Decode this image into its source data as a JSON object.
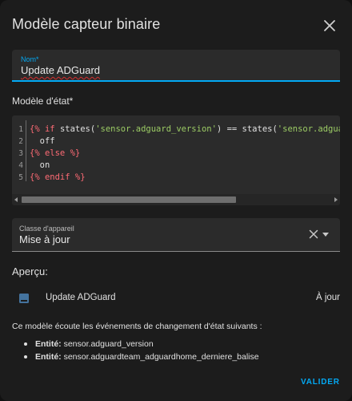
{
  "dialog": {
    "title": "Modèle capteur binaire",
    "close_icon": "close-icon"
  },
  "name_field": {
    "label": "Nom*",
    "value": "Update ADGuard"
  },
  "state_template": {
    "label": "Modèle d'état*",
    "line_numbers": [
      "1",
      "2",
      "3",
      "4",
      "5"
    ],
    "lines": [
      [
        {
          "text": "{% if ",
          "kind": "tag"
        },
        {
          "text": "states(",
          "kind": "plain"
        },
        {
          "text": "'sensor.adguard_version'",
          "kind": "str"
        },
        {
          "text": ") == ",
          "kind": "plain"
        },
        {
          "text": "states(",
          "kind": "plain"
        },
        {
          "text": "'sensor.adguardt",
          "kind": "str"
        }
      ],
      [
        {
          "text": "  off",
          "kind": "plain"
        }
      ],
      [
        {
          "text": "{% else %}",
          "kind": "tag"
        }
      ],
      [
        {
          "text": "  on",
          "kind": "plain"
        }
      ],
      [
        {
          "text": "{% endif %}",
          "kind": "tag"
        }
      ]
    ]
  },
  "device_class": {
    "label": "Classe d'appareil",
    "value": "Mise à jour",
    "clear_icon": "close-icon",
    "dropdown_icon": "chevron-down-icon"
  },
  "preview": {
    "heading": "Aperçu:",
    "entity_icon": "package-icon",
    "entity_name": "Update ADGuard",
    "entity_state": "À jour"
  },
  "listeners": {
    "intro": "Ce modèle écoute les événements de changement d'état suivants :",
    "items": [
      {
        "label": "Entité:",
        "value": "sensor.adguard_version"
      },
      {
        "label": "Entité:",
        "value": "sensor.adguardteam_adguardhome_derniere_balise"
      }
    ]
  },
  "footer": {
    "validate_label": "VALIDER"
  },
  "colors": {
    "accent": "#03a9f4",
    "dialog_bg": "#1c1c1c",
    "field_bg": "#2b2b2b",
    "template_tag": "#ff6b75",
    "template_string": "#9ccc65"
  }
}
